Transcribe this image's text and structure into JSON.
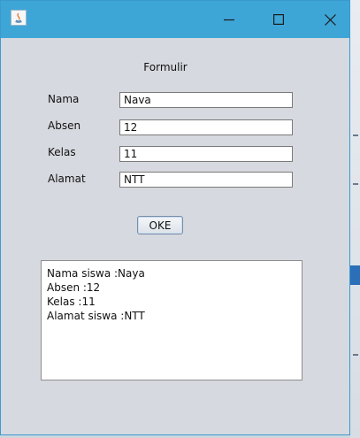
{
  "window": {
    "title": "",
    "buttons": {
      "minimize": "minimize-icon",
      "maximize": "maximize-icon",
      "close": "close-icon"
    }
  },
  "form": {
    "title": "Formulir",
    "fields": [
      {
        "label": "Nama",
        "value": "Nava"
      },
      {
        "label": "Absen",
        "value": "12"
      },
      {
        "label": "Kelas",
        "value": "11"
      },
      {
        "label": "Alamat",
        "value": "NTT"
      }
    ],
    "submit_label": "OKE"
  },
  "output": {
    "lines": [
      "Nama siswa :Naya",
      "Absen :12",
      "Kelas :11",
      "Alamat siswa :NTT"
    ]
  },
  "colors": {
    "titlebar": "#3ea6d7",
    "window_bg": "#d6d9df"
  }
}
